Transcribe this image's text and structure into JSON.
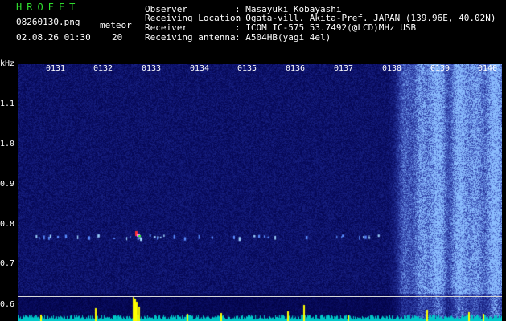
{
  "header": {
    "app_title": "HROFFT",
    "filename": "08260130.png",
    "datetime": "02.08.26 01:30",
    "meteor_label": "meteor",
    "meteor_count": "20",
    "observer_label": "Observer",
    "observer_value": ": Masayuki Kobayashi",
    "location_label": "Receiving Location",
    "location_value": ": Ogata-vill. Akita-Pref. JAPAN (139.96E, 40.02N)",
    "receiver_label": "Receiver",
    "receiver_value": ": ICOM IC-575 53.7492(@LCD)MHz USB",
    "antenna_label": "Receiving antenna",
    "antenna_value": ": A504HB(yagi 4el)"
  },
  "axis": {
    "y_unit": "kHz",
    "y_ticks": [
      "1.1",
      "1.0",
      "0.9",
      "0.8",
      "0.7",
      "0.6"
    ],
    "x_ticks": [
      "0131",
      "0132",
      "0133",
      "0134",
      "0135",
      "0136",
      "0137",
      "0138",
      "0139",
      "0140"
    ]
  },
  "colors": {
    "title": "#2fdc2f",
    "background": "#000000",
    "spectrum_low": "#0a0a6a",
    "spectrum_high": "#3a6cff",
    "meteor_echo": "#ff3030",
    "level_trace": "#ffff00",
    "baseline": "#00c8c8"
  }
}
